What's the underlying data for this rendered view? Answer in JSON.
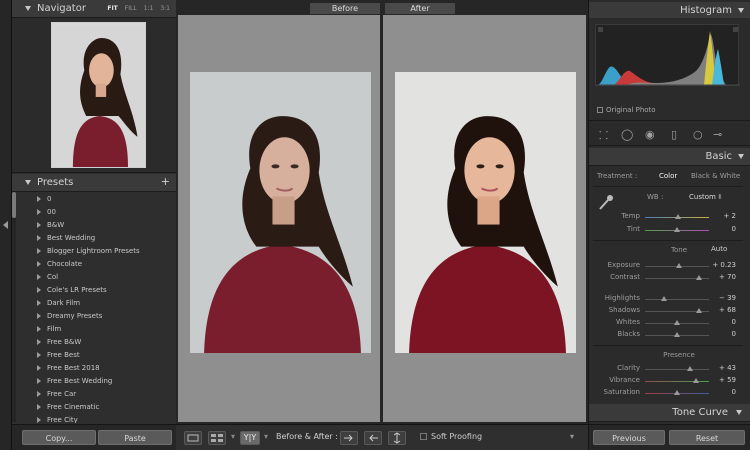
{
  "navigator": {
    "title": "Navigator",
    "zoom_options": [
      "FIT",
      "FILL",
      "1:1",
      "3:1"
    ]
  },
  "presets": {
    "title": "Presets",
    "add_label": "+",
    "items": [
      "0",
      "00",
      "B&W",
      "Best Wedding",
      "Blogger Lightroom Presets",
      "Chocolate",
      "Col",
      "Cole's LR Presets",
      "Dark Film",
      "Dreamy Presets",
      "Film",
      "Free B&W",
      "Free Best",
      "Free Best 2018",
      "Free Best Wedding",
      "Free Car",
      "Free Cinematic",
      "Free City"
    ]
  },
  "left_buttons": {
    "copy": "Copy...",
    "paste": "Paste"
  },
  "views": {
    "before_label": "Before",
    "after_label": "After"
  },
  "toolbar": {
    "yy_label": "Y|Y",
    "before_after_label": "Before & After :",
    "soft_proofing_label": "Soft Proofing"
  },
  "histogram": {
    "title": "Histogram",
    "original_photo_label": "Original Photo"
  },
  "basic": {
    "title": "Basic",
    "treatment_label": "Treatment :",
    "treatment_color": "Color",
    "treatment_bw": "Black & White",
    "wb_label": "WB :",
    "wb_value": "Custom",
    "tone_label": "Tone",
    "auto_label": "Auto",
    "presence_label": "Presence",
    "sliders": {
      "temp": {
        "label": "Temp",
        "value": "+ 2",
        "level": 0.52
      },
      "tint": {
        "label": "Tint",
        "value": "0",
        "level": 0.5
      },
      "exposure": {
        "label": "Exposure",
        "value": "+ 0.23",
        "level": 0.53
      },
      "contrast": {
        "label": "Contrast",
        "value": "+ 70",
        "level": 0.85
      },
      "highlights": {
        "label": "Highlights",
        "value": "− 39",
        "level": 0.3
      },
      "shadows": {
        "label": "Shadows",
        "value": "+ 68",
        "level": 0.84
      },
      "whites": {
        "label": "Whites",
        "value": "0",
        "level": 0.5
      },
      "blacks": {
        "label": "Blacks",
        "value": "0",
        "level": 0.5
      },
      "clarity": {
        "label": "Clarity",
        "value": "+ 43",
        "level": 0.71
      },
      "vibrance": {
        "label": "Vibrance",
        "value": "+ 59",
        "level": 0.8
      },
      "saturation": {
        "label": "Saturation",
        "value": "0",
        "level": 0.5
      }
    }
  },
  "tone_curve": {
    "title": "Tone Curve"
  },
  "right_buttons": {
    "previous": "Previous",
    "reset": "Reset"
  },
  "colors": {
    "panel": "#2e2e2e",
    "view_bg": "#8f8f8f",
    "hoodie": "#7a1e2e",
    "hair": "#2a1a14",
    "skin": "#e2b49a"
  }
}
